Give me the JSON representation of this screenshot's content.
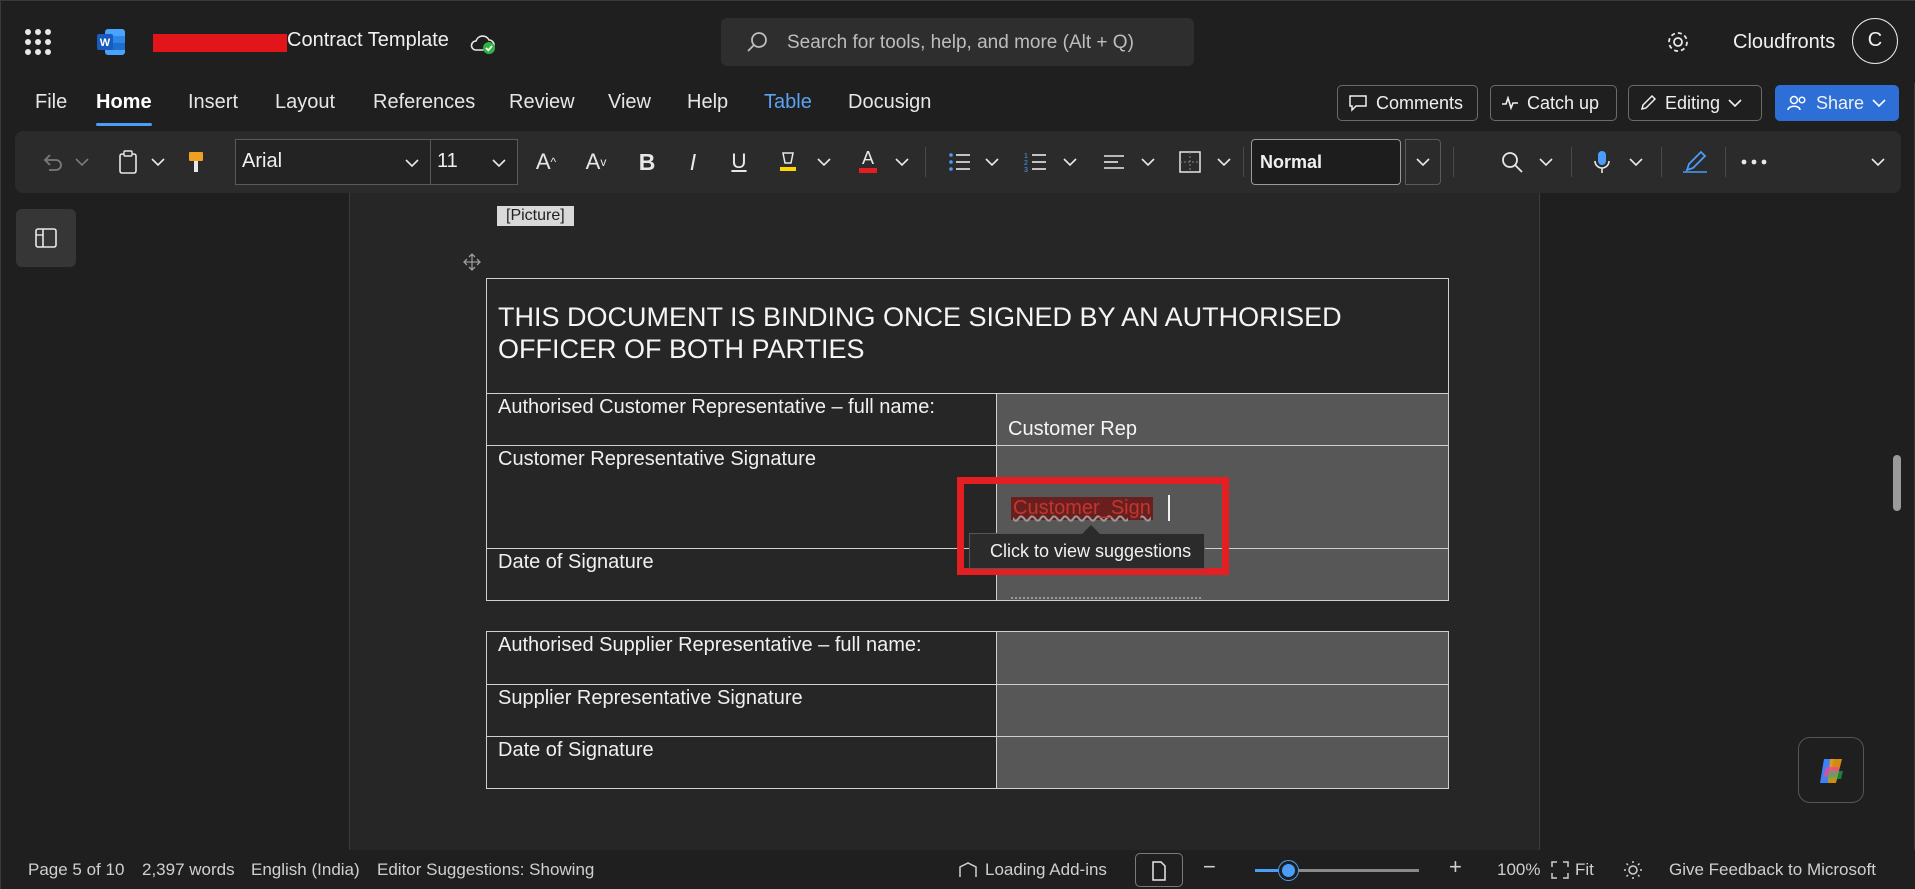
{
  "titlebar": {
    "doc_title": "Contract Template",
    "search_placeholder": "Search for tools, help, and more (Alt + Q)",
    "account_name": "Cloudfronts",
    "avatar_initial": "C"
  },
  "menu": {
    "tabs": [
      {
        "label": "File"
      },
      {
        "label": "Home"
      },
      {
        "label": "Insert"
      },
      {
        "label": "Layout"
      },
      {
        "label": "References"
      },
      {
        "label": "Review"
      },
      {
        "label": "View"
      },
      {
        "label": "Help"
      },
      {
        "label": "Table"
      },
      {
        "label": "Docusign"
      }
    ],
    "active_tab": "Home",
    "comments_label": "Comments",
    "catchup_label": "Catch up",
    "editing_label": "Editing",
    "share_label": "Share"
  },
  "ribbon": {
    "font_name": "Arial",
    "font_size": "11",
    "style_name": "Normal",
    "font_color": "#e41e21"
  },
  "document": {
    "picture_placeholder": "[Picture]",
    "heading": "THIS DOCUMENT IS BINDING ONCE SIGNED BY AN AUTHORISED OFFICER OF BOTH PARTIES",
    "customer_rows": [
      {
        "label": "Authorised Customer Representative – full name:",
        "value": "Customer Rep"
      },
      {
        "label": "Customer Representative Signature",
        "value": "Customer_Sign"
      },
      {
        "label": "Date of Signature",
        "value": ""
      }
    ],
    "supplier_rows": [
      {
        "label": "Authorised Supplier Representative – full name:",
        "value": ""
      },
      {
        "label": "Supplier Representative Signature",
        "value": ""
      },
      {
        "label": "Date of Signature",
        "value": ""
      }
    ],
    "tooltip": "Click to view suggestions"
  },
  "statusbar": {
    "page": "Page 5 of 10",
    "words": "2,397 words",
    "language": "English (India)",
    "editor": "Editor Suggestions: Showing",
    "addins": "Loading Add-ins",
    "zoom": "100%",
    "zoom_fraction": 0.2,
    "fit": "Fit",
    "feedback": "Give Feedback to Microsoft"
  },
  "colors": {
    "accent": "#4a9df8",
    "share": "#2d6fd6",
    "highlight_border": "#e41e21"
  }
}
